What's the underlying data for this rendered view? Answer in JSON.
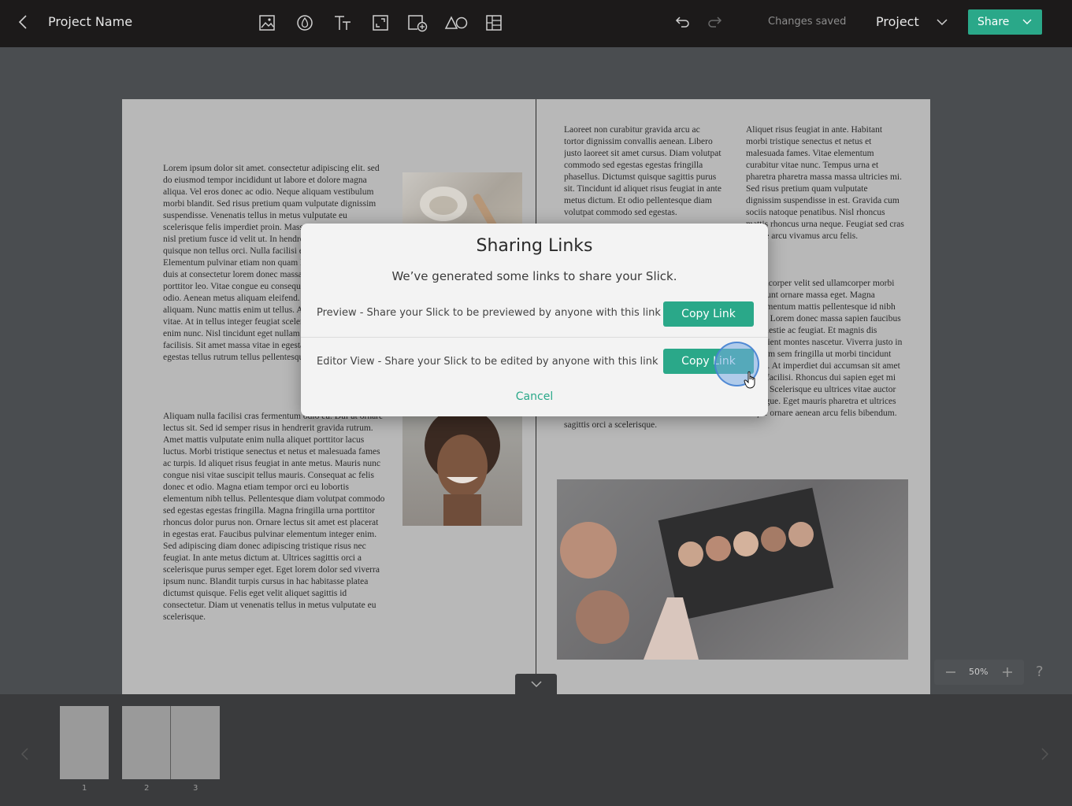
{
  "header": {
    "project_name": "Project Name",
    "status": "Changes saved",
    "project_menu_label": "Project",
    "share_label": "Share",
    "tools": [
      "image-icon",
      "color-drop-icon",
      "text-icon",
      "resize-icon",
      "add-page-icon",
      "shapes-icon",
      "layout-icon"
    ]
  },
  "page_left": {
    "column1": "Lorem ipsum dolor sit amet. consectetur adipiscing elit. sed do eiusmod tempor incididunt ut labore et dolore magna aliqua. Vel eros donec ac odio. Neque aliquam vestibulum morbi blandit. Sed risus pretium quam vulputate dignissim suspendisse. Venenatis tellus in metus vulputate eu scelerisque felis imperdiet proin. Massa tempor nec feugiat nisl pretium fusce id velit ut. In hendrerit gravida rutrum quisque non tellus orci. Nulla facilisi etiam quam. Elementum pulvinar etiam non quam lacus. Dictum varius duis at consectetur lorem donec massa. Mollis aliquam ut porttitor leo. Vitae congue eu consequat ac felis donec et odio. Aenean metus aliquam eleifend. Nunc id cursus metus aliquam. Nunc mattis enim ut tellus. At tellus at urna sagittis vitae. At in tellus integer feugiat scelerisque varius morbi enim nunc. Nisl tincidunt eget nullam non nisi est sit amet facilisis. Sit amet massa vitae in egestas erat. Orci phasellus egestas tellus rutrum tellus pellentesque quisque non",
    "column2": "Aliquam nulla facilisi cras fermentum odio eu. Dui ut ornare lectus sit. Sed id semper risus in hendrerit gravida rutrum. Amet mattis vulputate enim nulla aliquet porttitor lacus luctus. Morbi tristique senectus et netus et malesuada fames ac turpis. Id aliquet risus feugiat in ante metus. Mauris nunc congue nisi vitae suscipit tellus mauris. Consequat ac felis donec et odio. Magna etiam tempor orci eu lobortis elementum nibh tellus. Pellentesque diam volutpat commodo sed egestas egestas fringilla. Magna fringilla urna porttitor rhoncus dolor purus non. Ornare lectus sit amet est placerat in egestas erat. Faucibus pulvinar elementum integer enim. Sed adipiscing diam donec adipiscing tristique risus nec feugiat. In ante metus dictum at. Ultrices sagittis orci a scelerisque purus semper eget. Eget lorem dolor sed viverra ipsum nunc. Blandit turpis cursus in hac habitasse platea dictumst quisque. Felis eget velit aliquet sagittis id consectetur. Diam ut venenatis tellus in metus vulputate eu scelerisque."
  },
  "page_right": {
    "column1": "Laoreet non curabitur gravida arcu ac tortor dignissim convallis aenean. Libero justo laoreet sit amet cursus. Diam volutpat commodo sed egestas egestas fringilla phasellus. Dictumst quisque sagittis purus sit. Tincidunt id aliquet risus feugiat in ante metus dictum. Et odio pellentesque diam volutpat commodo sed egestas.",
    "column1_tail": "sagittis orci a scelerisque.",
    "column2a": "Aliquet risus feugiat in ante. Habitant morbi tristique senectus et netus et malesuada fames. Vitae elementum curabitur vitae nunc. Tempus urna et pharetra pharetra massa massa ultricies mi. Sed risus pretium quam vulputate dignissim suspendisse in est. Gravida cum sociis natoque penatibus. Nisl rhoncus mattis rhoncus urna neque. Feugiat sed cras ornare arcu vivamus arcu felis.",
    "column2b": "Ullamcorper velit sed ullamcorper morbi tincidunt ornare massa eget. Magna condimentum mattis pellentesque id nibh tortor. Lorem donec massa sapien faucibus et molestie ac feugiat. Et magnis dis parturient montes nascetur. Viverra justo in aliquam sem fringilla ut morbi tincidunt augue. At imperdiet dui accumsan sit amet nulla facilisi. Rhoncus dui sapien eget mi proin. Scelerisque eu ultrices vitae auctor eu augue. Eget mauris pharetra et ultrices neque ornare aenean arcu felis bibendum."
  },
  "zoom": {
    "value": "50%",
    "help": "?"
  },
  "filmstrip": {
    "pages": [
      "1",
      "2",
      "3"
    ]
  },
  "modal": {
    "title": "Sharing Links",
    "subtitle": "We’ve generated some links to share your Slick.",
    "preview_label": "Preview - Share your Slick to be previewed by anyone with this link",
    "editor_label": "Editor View - Share your Slick to be edited by anyone with this link",
    "copy_label": "Copy Link",
    "cancel_label": "Cancel"
  },
  "colors": {
    "accent": "#2aa889",
    "topbar": "#1c1a1a",
    "workspace": "#4a4d50"
  }
}
